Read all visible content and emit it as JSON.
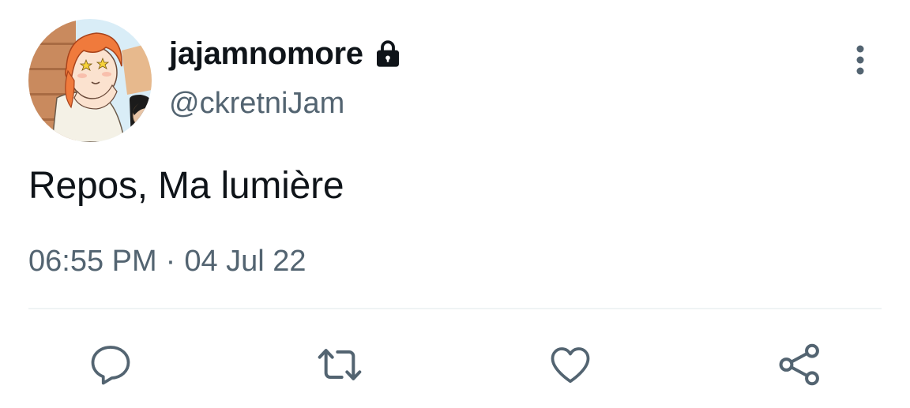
{
  "user": {
    "display_name": "jajamnomore",
    "handle": "@ckretniJam",
    "protected_icon": "lock-icon",
    "avatar": "cartoon-character-avatar"
  },
  "tweet": {
    "text": "Repos, Ma lumière",
    "time": "06:55 PM",
    "separator": "·",
    "date": "04 Jul 22"
  },
  "actions": [
    {
      "icon": "reply-icon"
    },
    {
      "icon": "retweet-icon"
    },
    {
      "icon": "like-icon"
    },
    {
      "icon": "share-icon"
    }
  ],
  "more_icon": "more-vertical-icon",
  "colors": {
    "text_primary": "#0f1419",
    "text_secondary": "#536471",
    "icon": "#536471",
    "divider": "#eff3f4"
  }
}
